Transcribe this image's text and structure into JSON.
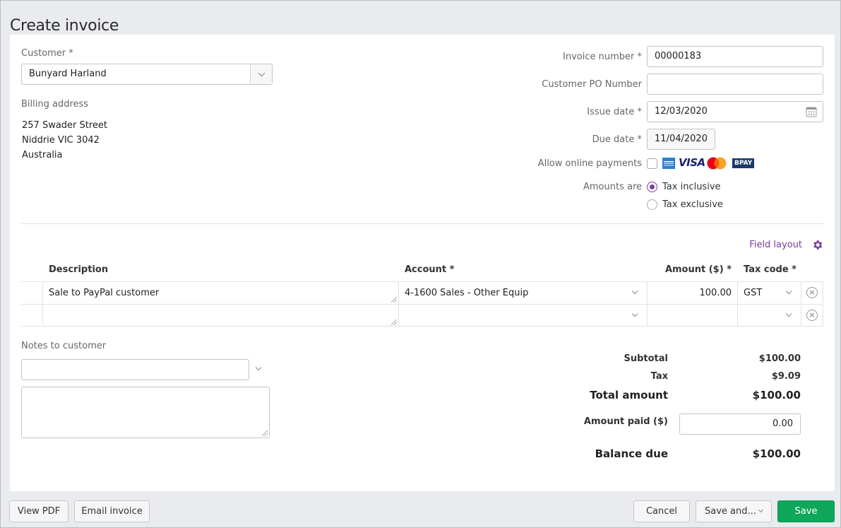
{
  "page": {
    "title": "Create invoice"
  },
  "customer": {
    "label": "Customer",
    "required_mark": "*",
    "value": "Bunyard Harland"
  },
  "billing": {
    "label": "Billing address",
    "lines": [
      "257 Swader Street",
      "Niddrie VIC 3042",
      "Australia"
    ]
  },
  "invoice_fields": {
    "invoice_number_label": "Invoice number *",
    "invoice_number": "00000183",
    "po_label": "Customer PO Number",
    "po_value": "",
    "issue_date_label": "Issue date *",
    "issue_date": "12/03/2020",
    "due_date_label": "Due date *",
    "due_date": "11/04/2020",
    "online_payments_label": "Allow online payments",
    "online_payments_checked": false,
    "payment_logos": [
      "amex",
      "VISA",
      "mastercard",
      "BPAY"
    ],
    "amounts_are_label": "Amounts are",
    "tax_options": [
      {
        "label": "Tax inclusive",
        "selected": true
      },
      {
        "label": "Tax exclusive",
        "selected": false
      }
    ]
  },
  "field_layout": {
    "label": "Field layout"
  },
  "lines_table": {
    "headers": {
      "description": "Description",
      "account": "Account *",
      "amount": "Amount ($) *",
      "tax_code": "Tax code *"
    },
    "rows": [
      {
        "description": "Sale to PayPal customer",
        "account": "4-1600 Sales - Other Equip",
        "amount": "100.00",
        "tax_code": "GST"
      },
      {
        "description": "",
        "account": "",
        "amount": "",
        "tax_code": ""
      }
    ]
  },
  "notes": {
    "label": "Notes to customer",
    "select_value": "",
    "text": ""
  },
  "totals": {
    "subtotal_label": "Subtotal",
    "subtotal": "$100.00",
    "tax_label": "Tax",
    "tax": "$9.09",
    "total_label": "Total amount",
    "total": "$100.00",
    "amount_paid_label": "Amount paid ($)",
    "amount_paid": "0.00",
    "balance_label": "Balance due",
    "balance": "$100.00"
  },
  "footer": {
    "view_pdf": "View PDF",
    "email_invoice": "Email invoice",
    "cancel": "Cancel",
    "save_and": "Save and...",
    "save": "Save"
  },
  "colors": {
    "accent": "#7a3fa0",
    "primary_button": "#0fa75a"
  }
}
